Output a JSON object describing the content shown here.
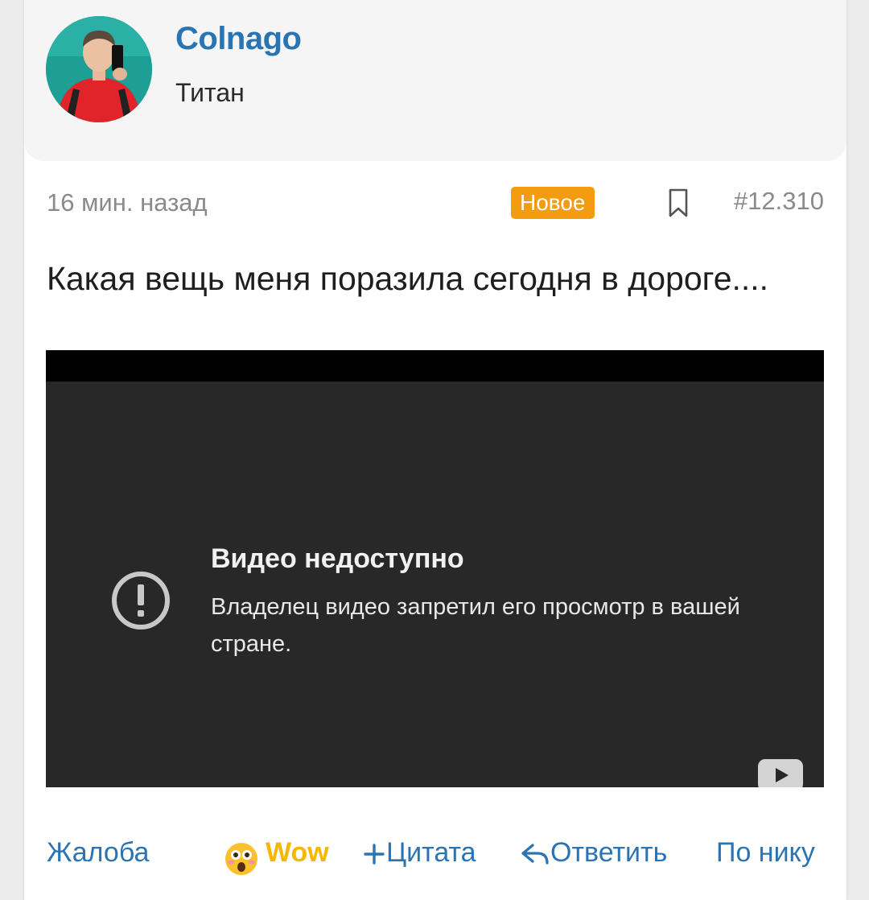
{
  "author": {
    "name": "Colnago",
    "title": "Титан"
  },
  "post": {
    "time": "16 мин. назад",
    "badge": "Новое",
    "number": "#12.310",
    "text": "Какая вещь меня поразила сегодня в дороге....",
    "bookmark_icon": "bookmark-icon"
  },
  "video": {
    "title": "Видео недоступно",
    "message": "Владелец видео запретил его просмотр в вашей стране.",
    "warning_icon": "exclamation-circle-icon",
    "logo_icon": "youtube-logo-icon"
  },
  "actions": {
    "report": "Жалоба",
    "reaction": "Wow",
    "reaction_icon": "astonished-face-emoji",
    "quote": "Цитата",
    "reply": "Ответить",
    "by_nick": "По нику"
  },
  "colors": {
    "link": "#2b74b3",
    "badge": "#f39c12",
    "reaction": "#f5b700",
    "video_bg": "#282828"
  }
}
